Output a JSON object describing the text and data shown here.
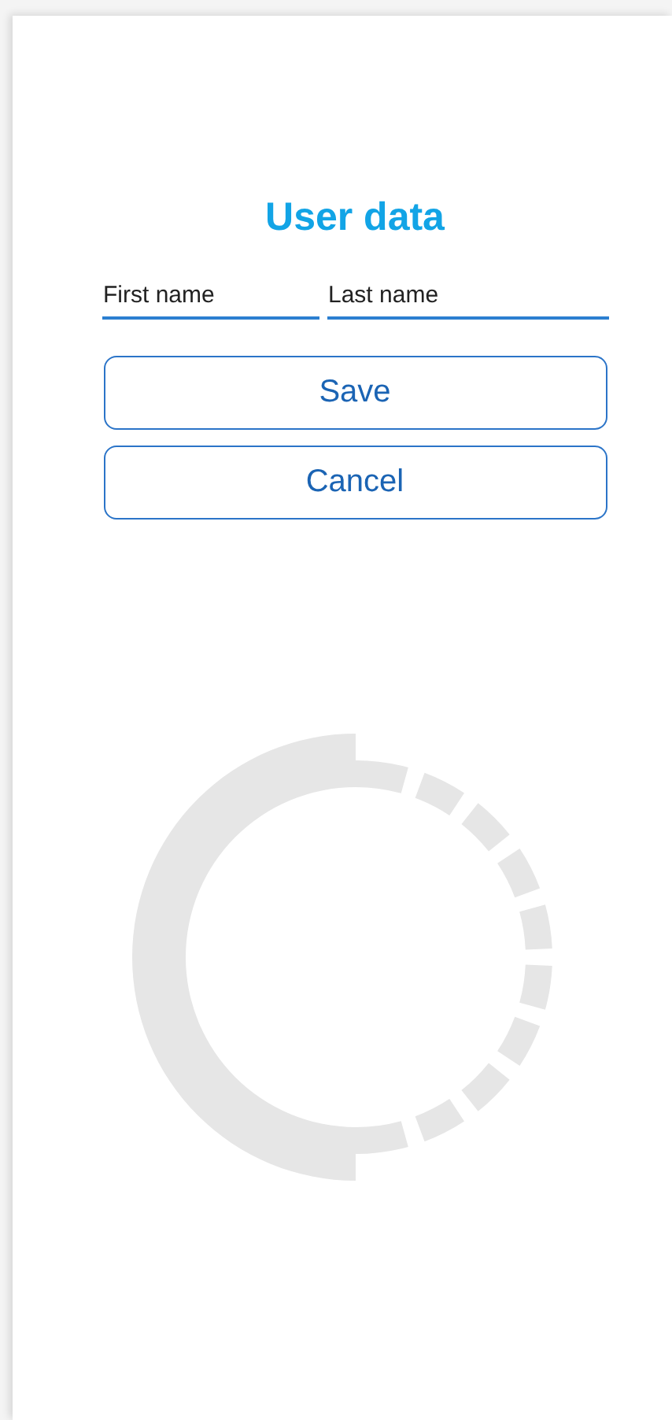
{
  "title": "User data",
  "fields": [
    {
      "placeholder": "First name"
    },
    {
      "placeholder": "Last name"
    }
  ],
  "buttons": [
    {
      "label": "Save"
    },
    {
      "label": "Cancel"
    }
  ]
}
